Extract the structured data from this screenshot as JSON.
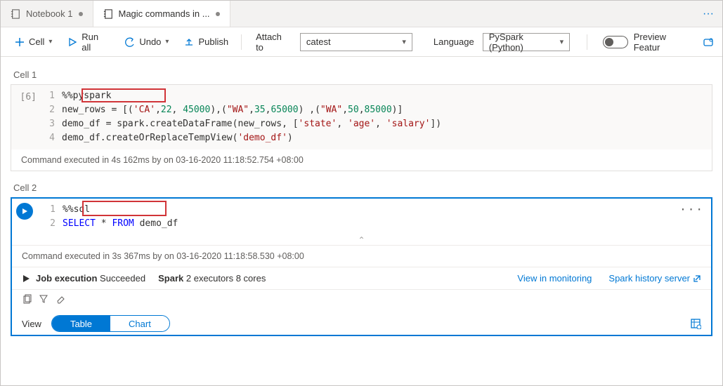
{
  "tabs": {
    "items": [
      {
        "label": "Notebook 1",
        "dirty": true,
        "active": false
      },
      {
        "label": "Magic commands in ...",
        "dirty": true,
        "active": true
      }
    ],
    "more": "···"
  },
  "toolbar": {
    "cell": "Cell",
    "runall": "Run all",
    "undo": "Undo",
    "publish": "Publish",
    "attach_label": "Attach to",
    "attach_value": "catest",
    "language_label": "Language",
    "language_value": "PySpark (Python)",
    "preview_label": "Preview Featur"
  },
  "cell1": {
    "label": "Cell 1",
    "exec_count": "[6]",
    "magic": "%%pyspark",
    "lines": [
      "%%pyspark",
      "new_rows = [('CA',22, 45000),(\"WA\",35,65000) ,(\"WA\",50,85000)]",
      "demo_df = spark.createDataFrame(new_rows, ['state', 'age', 'salary'])",
      "demo_df.createOrReplaceTempView('demo_df')"
    ],
    "status": "Command executed in 4s 162ms by        on 03-16-2020 11:18:52.754 +08:00"
  },
  "cell2": {
    "label": "Cell 2",
    "magic": "%%sql",
    "lines": [
      "%%sql",
      "SELECT * FROM demo_df"
    ],
    "status": "Command executed in 3s 367ms by        on 03-16-2020 11:18:58.530 +08:00",
    "job_prefix": "Job execution",
    "job_status": "Succeeded",
    "spark_prefix": "Spark",
    "spark_detail": "2 executors 8 cores",
    "link_monitoring": "View in monitoring",
    "link_history": "Spark history server",
    "view_label": "View",
    "seg_table": "Table",
    "seg_chart": "Chart",
    "more": "···"
  }
}
